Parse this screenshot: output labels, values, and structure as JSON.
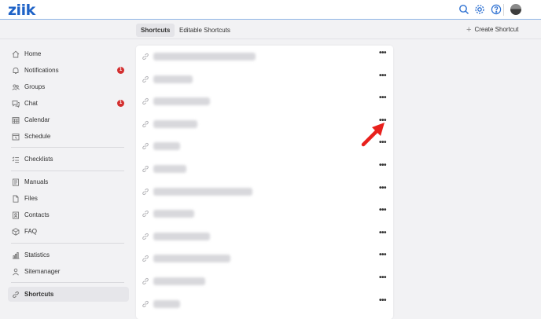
{
  "app": {
    "logo_text": "ziik"
  },
  "topbar": {
    "icons": [
      "search-icon",
      "gear-icon",
      "help-icon"
    ],
    "avatar": "avatar"
  },
  "tabs": [
    {
      "label": "Shortcuts",
      "active": true
    },
    {
      "label": "Editable Shortcuts",
      "active": false
    }
  ],
  "create_button": {
    "label": "Create Shortcut",
    "icon": "plus-icon"
  },
  "sidebar": {
    "items": [
      {
        "label": "Home",
        "icon": "home-icon"
      },
      {
        "label": "Notifications",
        "icon": "bell-icon",
        "badge": "1"
      },
      {
        "label": "Groups",
        "icon": "groups-icon"
      },
      {
        "label": "Chat",
        "icon": "chat-icon",
        "badge": "1"
      },
      {
        "label": "Calendar",
        "icon": "calendar-icon"
      },
      {
        "label": "Schedule",
        "icon": "schedule-icon"
      },
      {
        "label": "Checklists",
        "icon": "checklist-icon"
      },
      {
        "label": "Manuals",
        "icon": "manual-icon"
      },
      {
        "label": "Files",
        "icon": "files-icon"
      },
      {
        "label": "Contacts",
        "icon": "contacts-icon"
      },
      {
        "label": "FAQ",
        "icon": "faq-icon"
      },
      {
        "label": "Statistics",
        "icon": "statistics-icon"
      },
      {
        "label": "Sitemanager",
        "icon": "sitemanager-icon"
      },
      {
        "label": "Shortcuts",
        "icon": "link-icon",
        "active": true
      }
    ]
  },
  "shortcuts": {
    "row_count": 12,
    "menu_label": "•••",
    "row_icon": "link-icon"
  },
  "colors": {
    "brand": "#1f63c7",
    "badge": "#d32f2f",
    "arrow": "#e8201c"
  }
}
